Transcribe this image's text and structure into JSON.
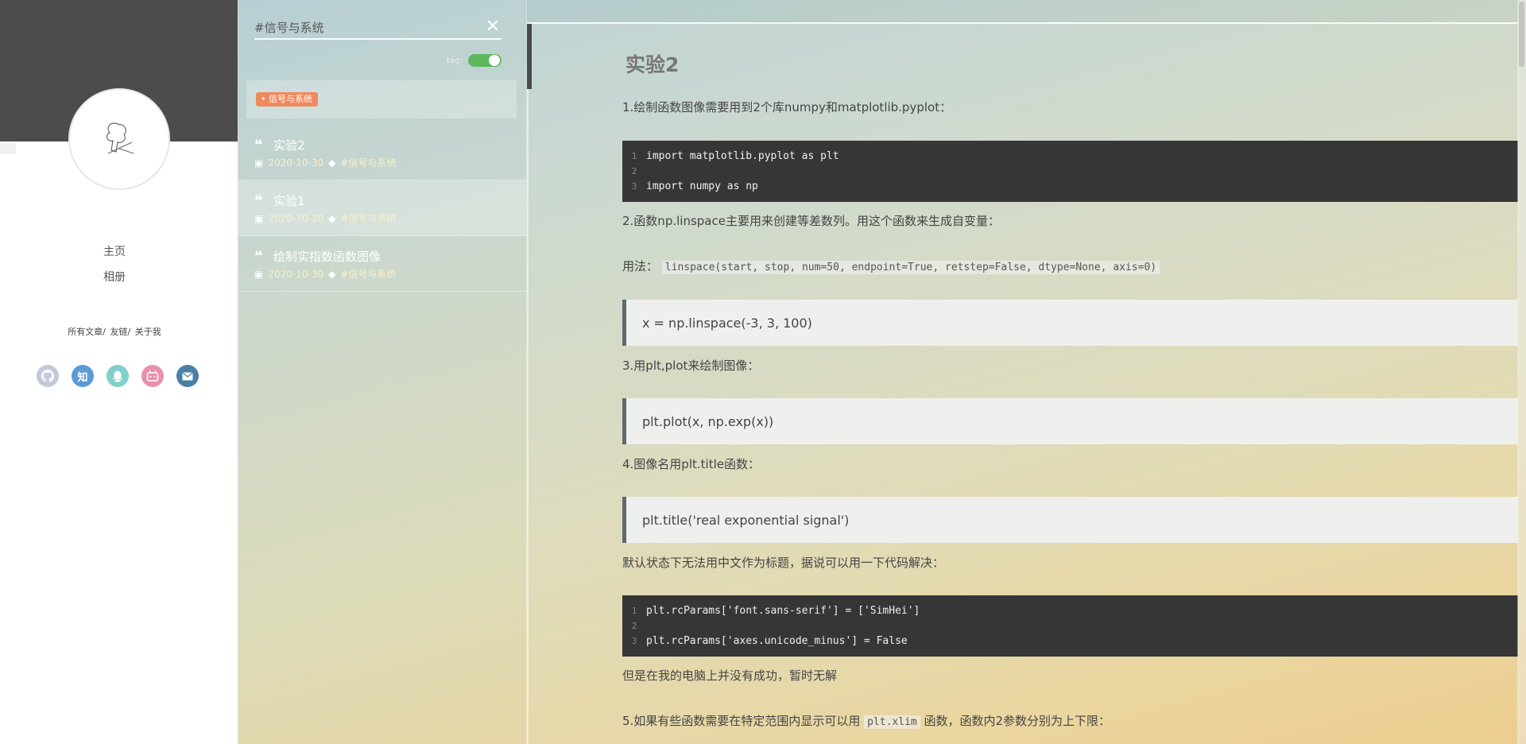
{
  "profile": {
    "nav": [
      "主页",
      "相册"
    ],
    "links": [
      "所有文章/",
      "友链/",
      "关于我"
    ],
    "socials": [
      {
        "name": "github-icon",
        "glyph": "",
        "color": "#c3c9d9"
      },
      {
        "name": "zhihu-icon",
        "glyph": "知",
        "color": "#5b9ad8"
      },
      {
        "name": "qq-icon",
        "glyph": "",
        "color": "#7fd0cc"
      },
      {
        "name": "bilibili-icon",
        "glyph": "",
        "color": "#e790ad"
      },
      {
        "name": "mail-icon",
        "glyph": "",
        "color": "#4a7fa6"
      }
    ]
  },
  "search": {
    "value": "#信号与系统",
    "tag_label": "tag:"
  },
  "active_tag": "信号与系统",
  "posts": [
    {
      "title": "实验2",
      "date": "2020-10-30",
      "tag": "#信号与系统"
    },
    {
      "title": "实验1",
      "date": "2020-10-30",
      "tag": "#信号与系统"
    },
    {
      "title": "绘制实指数函数图像",
      "date": "2020-10-30",
      "tag": "#信号与系统"
    }
  ],
  "article": {
    "title": "实验2",
    "p1": "1.绘制函数图像需要用到2个库numpy和matplotlib.pyplot：",
    "code1": [
      {
        "n": "1",
        "t": "import matplotlib.pyplot as plt"
      },
      {
        "n": "2",
        "t": ""
      },
      {
        "n": "3",
        "t": "import numpy as np"
      }
    ],
    "p2": "2.函数np.linspace主要用来创建等差数列。用这个函数来生成自变量：",
    "p3_prefix": "用法：",
    "p3_code": "linspace(start, stop, num=50, endpoint=True, retstep=False, dtype=None, axis=0)",
    "q1": "x = np.linspace(-3, 3, 100)",
    "p4": "3.用plt,plot来绘制图像：",
    "q2": "plt.plot(x, np.exp(x))",
    "p5": "4.图像名用plt.title函数：",
    "q3": "plt.title('real exponential signal')",
    "p6": "默认状态下无法用中文作为标题，据说可以用一下代码解决：",
    "code2": [
      {
        "n": "1",
        "t": "plt.rcParams['font.sans-serif'] = ['SimHei']"
      },
      {
        "n": "2",
        "t": ""
      },
      {
        "n": "3",
        "t": "plt.rcParams['axes.unicode_minus'] = False"
      }
    ],
    "p7": "但是在我的电脑上并没有成功，暂时无解",
    "p8_prefix": "5.如果有些函数需要在特定范围内显示可以用",
    "p8_code": "plt.xlim",
    "p8_suffix": "函数，函数内2参数分别为上下限："
  }
}
